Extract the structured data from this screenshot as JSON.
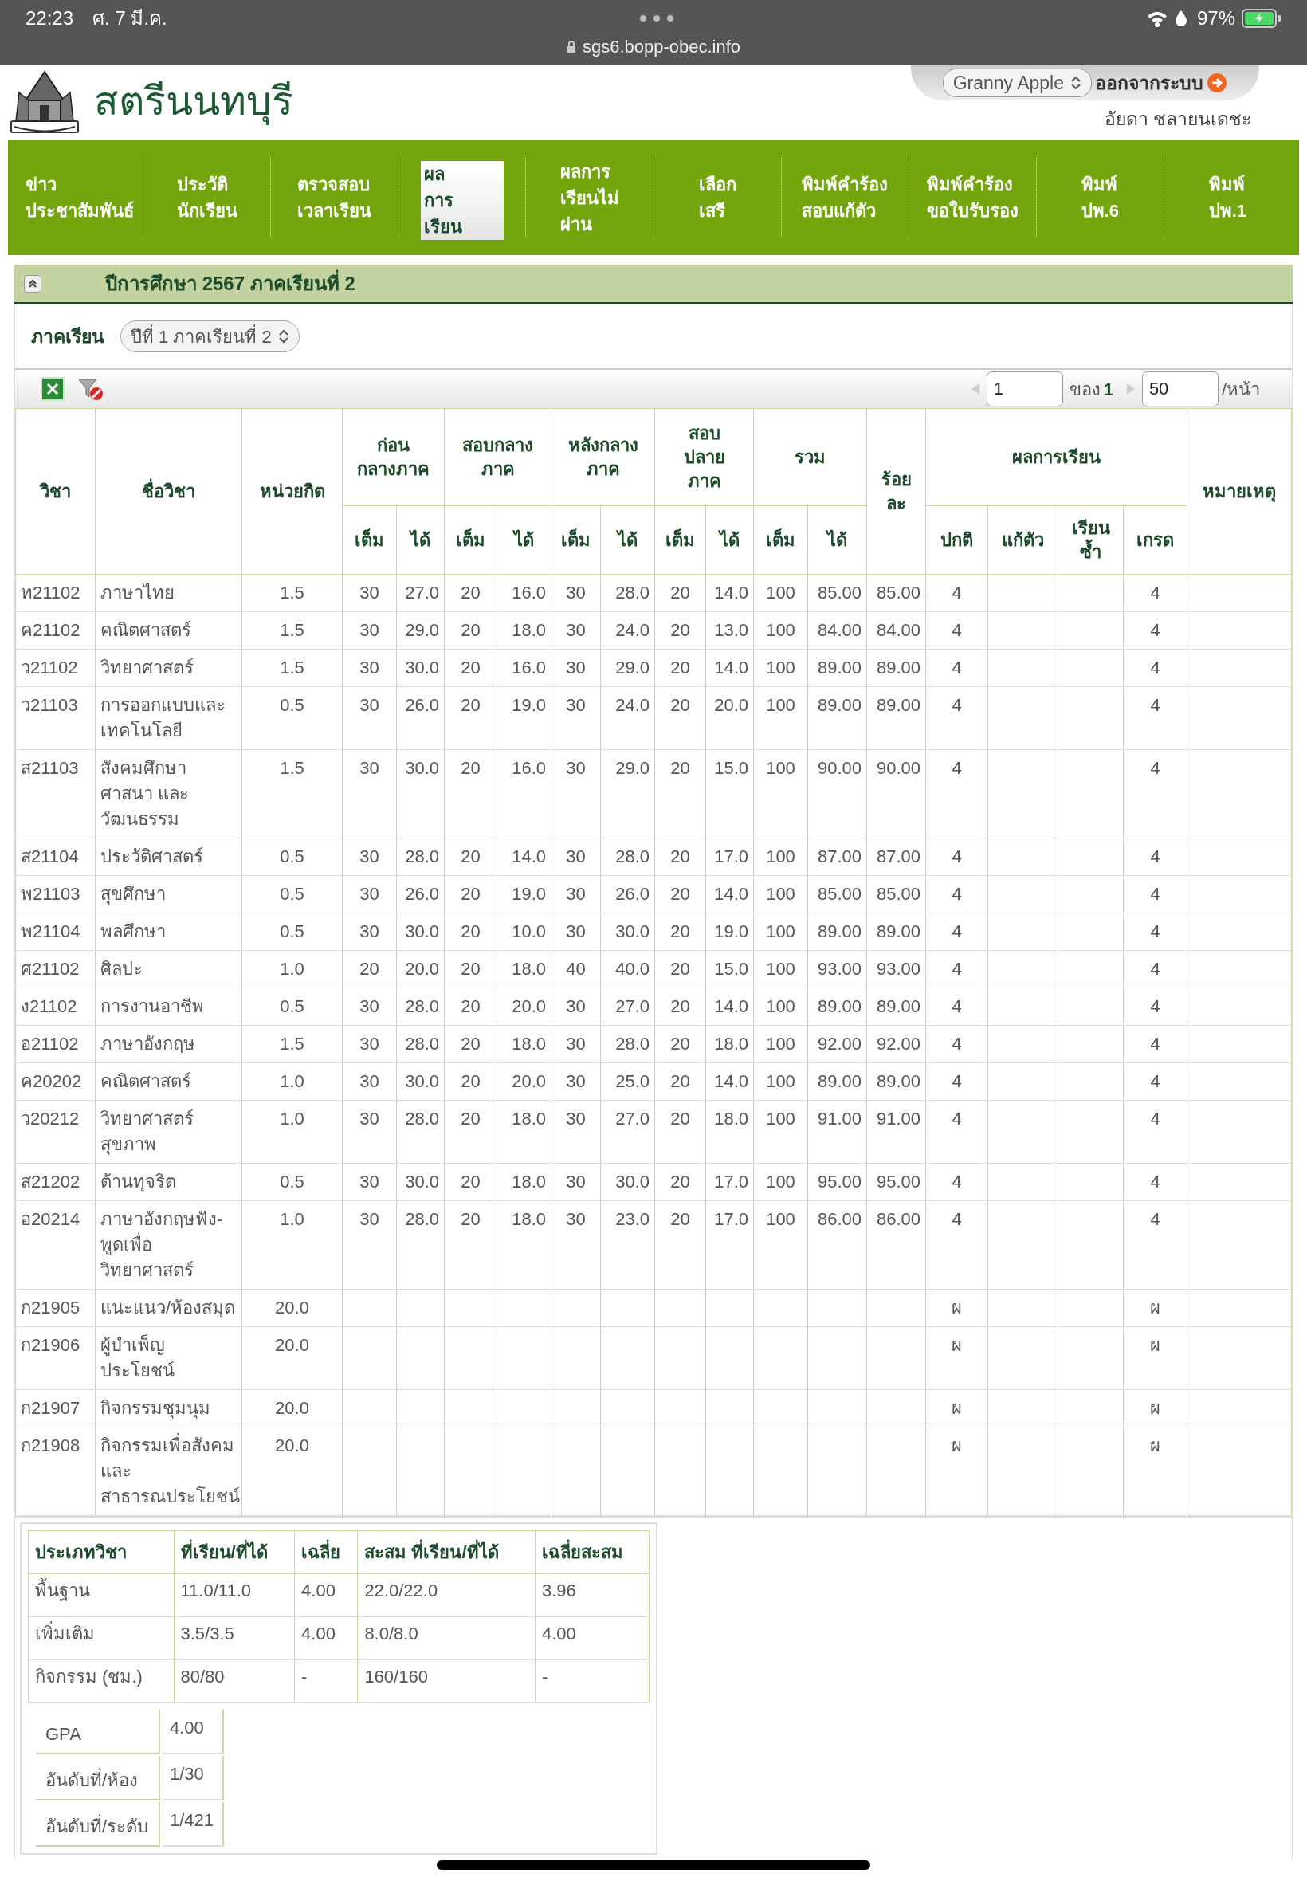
{
  "status_bar": {
    "time": "22:23",
    "date": "ศ. 7 มี.ค.",
    "url": "sgs6.bopp-obec.info",
    "battery": "97%"
  },
  "header": {
    "school_name": "สตรีนนทบุรี",
    "account_select": "Granny Apple",
    "logout": "ออกจากระบบ",
    "user_name": "อัยดา ชลายนเดชะ"
  },
  "nav": [
    {
      "label": "ข่าว\nประชาสัมพันธ์",
      "selected": false
    },
    {
      "label": "ประวัติ\nนักเรียน",
      "selected": false
    },
    {
      "label": "ตรวจสอบ\nเวลาเรียน",
      "selected": false
    },
    {
      "label": "ผล\nการ\nเรียน",
      "selected": true
    },
    {
      "label": "ผลการ\nเรียนไม่\nผ่าน",
      "selected": false
    },
    {
      "label": "เลือก\nเสรี",
      "selected": false
    },
    {
      "label": "พิมพ์คำร้อง\nสอบแก้ตัว",
      "selected": false
    },
    {
      "label": "พิมพ์คำร้อง\nขอใบรับรอง",
      "selected": false
    },
    {
      "label": "พิมพ์\nปพ.6",
      "selected": false
    },
    {
      "label": "พิมพ์\nปพ.1",
      "selected": false
    }
  ],
  "section": {
    "title": "ปีการศึกษา 2567 ภาคเรียนที่ 2",
    "expanded": true,
    "semester_label": "ภาคเรียน",
    "semester_select": "ปีที่ 1 ภาคเรียนที่ 2"
  },
  "pager": {
    "page": "1",
    "of_label": "ของ",
    "total_pages": "1",
    "per_page": "50",
    "per_page_label": "/หน้า"
  },
  "table": {
    "columns": {
      "code": "วิชา",
      "name": "ชื่อวิชา",
      "credit": "หน่วยกิต",
      "groups": [
        "ก่อน\nกลางภาค",
        "สอบกลาง\nภาค",
        "หลังกลาง\nภาค",
        "สอบ\nปลาย\nภาค",
        "รวม"
      ],
      "sub": [
        "เต็ม",
        "ได้",
        "เต็ม",
        "ได้",
        "เต็ม",
        "ได้",
        "เต็ม",
        "ได้",
        "เต็ม",
        "ได้"
      ],
      "percent": "ร้อย\nละ",
      "result": "ผลการเรียน",
      "result_sub": [
        "ปกติ",
        "แก้ตัว",
        "เรียน\nซ้ำ",
        "เกรด"
      ],
      "note": "หมายเหตุ"
    },
    "rows": [
      {
        "code": "ท21102",
        "name": "ภาษาไทย",
        "credit": "1.5",
        "scores": [
          "30",
          "27.0",
          "20",
          "16.0",
          "30",
          "28.0",
          "20",
          "14.0",
          "100",
          "85.00"
        ],
        "percent": "85.00",
        "normal": "4",
        "grade": "4"
      },
      {
        "code": "ค21102",
        "name": "คณิตศาสตร์",
        "credit": "1.5",
        "scores": [
          "30",
          "29.0",
          "20",
          "18.0",
          "30",
          "24.0",
          "20",
          "13.0",
          "100",
          "84.00"
        ],
        "percent": "84.00",
        "normal": "4",
        "grade": "4"
      },
      {
        "code": "ว21102",
        "name": "วิทยาศาสตร์",
        "credit": "1.5",
        "scores": [
          "30",
          "30.0",
          "20",
          "16.0",
          "30",
          "29.0",
          "20",
          "14.0",
          "100",
          "89.00"
        ],
        "percent": "89.00",
        "normal": "4",
        "grade": "4"
      },
      {
        "code": "ว21103",
        "name": "การออกแบบและ\nเทคโนโลยี",
        "credit": "0.5",
        "scores": [
          "30",
          "26.0",
          "20",
          "19.0",
          "30",
          "24.0",
          "20",
          "20.0",
          "100",
          "89.00"
        ],
        "percent": "89.00",
        "normal": "4",
        "grade": "4"
      },
      {
        "code": "ส21103",
        "name": "สังคมศึกษา\nศาสนา และ\nวัฒนธรรม",
        "credit": "1.5",
        "scores": [
          "30",
          "30.0",
          "20",
          "16.0",
          "30",
          "29.0",
          "20",
          "15.0",
          "100",
          "90.00"
        ],
        "percent": "90.00",
        "normal": "4",
        "grade": "4"
      },
      {
        "code": "ส21104",
        "name": "ประวัติศาสตร์",
        "credit": "0.5",
        "scores": [
          "30",
          "28.0",
          "20",
          "14.0",
          "30",
          "28.0",
          "20",
          "17.0",
          "100",
          "87.00"
        ],
        "percent": "87.00",
        "normal": "4",
        "grade": "4"
      },
      {
        "code": "พ21103",
        "name": "สุขศึกษา",
        "credit": "0.5",
        "scores": [
          "30",
          "26.0",
          "20",
          "19.0",
          "30",
          "26.0",
          "20",
          "14.0",
          "100",
          "85.00"
        ],
        "percent": "85.00",
        "normal": "4",
        "grade": "4"
      },
      {
        "code": "พ21104",
        "name": "พลศึกษา",
        "credit": "0.5",
        "scores": [
          "30",
          "30.0",
          "20",
          "10.0",
          "30",
          "30.0",
          "20",
          "19.0",
          "100",
          "89.00"
        ],
        "percent": "89.00",
        "normal": "4",
        "grade": "4"
      },
      {
        "code": "ศ21102",
        "name": "ศิลปะ",
        "credit": "1.0",
        "scores": [
          "20",
          "20.0",
          "20",
          "18.0",
          "40",
          "40.0",
          "20",
          "15.0",
          "100",
          "93.00"
        ],
        "percent": "93.00",
        "normal": "4",
        "grade": "4"
      },
      {
        "code": "ง21102",
        "name": "การงานอาชีพ",
        "credit": "0.5",
        "scores": [
          "30",
          "28.0",
          "20",
          "20.0",
          "30",
          "27.0",
          "20",
          "14.0",
          "100",
          "89.00"
        ],
        "percent": "89.00",
        "normal": "4",
        "grade": "4"
      },
      {
        "code": "อ21102",
        "name": "ภาษาอังกฤษ",
        "credit": "1.5",
        "scores": [
          "30",
          "28.0",
          "20",
          "18.0",
          "30",
          "28.0",
          "20",
          "18.0",
          "100",
          "92.00"
        ],
        "percent": "92.00",
        "normal": "4",
        "grade": "4"
      },
      {
        "code": "ค20202",
        "name": "คณิตศาสตร์",
        "credit": "1.0",
        "scores": [
          "30",
          "30.0",
          "20",
          "20.0",
          "30",
          "25.0",
          "20",
          "14.0",
          "100",
          "89.00"
        ],
        "percent": "89.00",
        "normal": "4",
        "grade": "4"
      },
      {
        "code": "ว20212",
        "name": "วิทยาศาสตร์\nสุขภาพ",
        "credit": "1.0",
        "scores": [
          "30",
          "28.0",
          "20",
          "18.0",
          "30",
          "27.0",
          "20",
          "18.0",
          "100",
          "91.00"
        ],
        "percent": "91.00",
        "normal": "4",
        "grade": "4"
      },
      {
        "code": "ส21202",
        "name": "ต้านทุจริต",
        "credit": "0.5",
        "scores": [
          "30",
          "30.0",
          "20",
          "18.0",
          "30",
          "30.0",
          "20",
          "17.0",
          "100",
          "95.00"
        ],
        "percent": "95.00",
        "normal": "4",
        "grade": "4"
      },
      {
        "code": "อ20214",
        "name": "ภาษาอังกฤษฟัง-\nพูดเพื่อ\nวิทยาศาสตร์",
        "credit": "1.0",
        "scores": [
          "30",
          "28.0",
          "20",
          "18.0",
          "30",
          "23.0",
          "20",
          "17.0",
          "100",
          "86.00"
        ],
        "percent": "86.00",
        "normal": "4",
        "grade": "4"
      },
      {
        "code": "ก21905",
        "name": "แนะแนว/ห้องสมุด",
        "credit": "20.0",
        "normal": "ผ",
        "grade": "ผ"
      },
      {
        "code": "ก21906",
        "name": "ผู้บำเพ็ญ\nประโยชน์",
        "credit": "20.0",
        "normal": "ผ",
        "grade": "ผ"
      },
      {
        "code": "ก21907",
        "name": "กิจกรรมชุมนุม",
        "credit": "20.0",
        "normal": "ผ",
        "grade": "ผ"
      },
      {
        "code": "ก21908",
        "name": "กิจกรรมเพื่อสังคม\nและ\nสาธารณประโยชน์",
        "credit": "20.0",
        "normal": "ผ",
        "grade": "ผ"
      }
    ]
  },
  "summary": {
    "columns": [
      "ประเภทวิชา",
      "ที่เรียน/ที่ได้",
      "เฉลี่ย",
      "สะสม ที่เรียน/ที่ได้",
      "เฉลี่ยสะสม"
    ],
    "rows": [
      [
        "พื้นฐาน",
        "11.0/11.0",
        "4.00",
        "22.0/22.0",
        "3.96"
      ],
      [
        "เพิ่มเติม",
        "3.5/3.5",
        "4.00",
        "8.0/8.0",
        "4.00"
      ],
      [
        "กิจกรรม (ชม.)",
        "80/80",
        "-",
        "160/160",
        "-"
      ]
    ],
    "stats": [
      {
        "label": "GPA",
        "value": "4.00"
      },
      {
        "label": "อันดับที่/ห้อง",
        "value": "1/30"
      },
      {
        "label": "อันดับที่/ระดับ",
        "value": "1/421"
      }
    ]
  }
}
